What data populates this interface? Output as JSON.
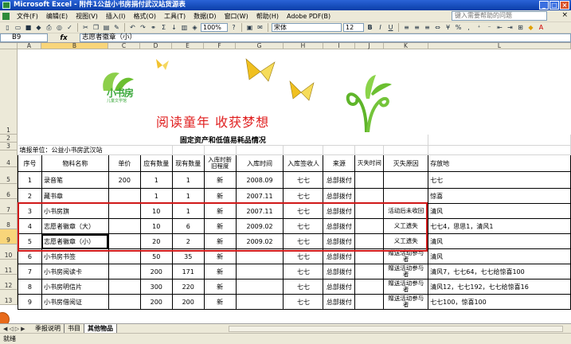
{
  "window": {
    "title": "Microsoft Excel - 附件1公益小书房捐付武汉站货源表",
    "controls": [
      "_",
      "□",
      "×"
    ]
  },
  "menu": {
    "items": [
      "文件(F)",
      "编辑(E)",
      "视图(V)",
      "插入(I)",
      "格式(O)",
      "工具(T)",
      "数据(D)",
      "窗口(W)",
      "帮助(H)",
      "Adobe PDF(B)"
    ],
    "help_placeholder": "键入需要帮助的问题",
    "close": "× "
  },
  "toolbar": {
    "zoom": "100%",
    "font": "宋体",
    "font_size": "12",
    "bold": "B",
    "italic": "I",
    "underline": "U"
  },
  "formula_bar": {
    "name_box": "B9",
    "fx": "fx",
    "content": "志愿者徽章（小）"
  },
  "columns": [
    "A",
    "B",
    "C",
    "D",
    "E",
    "F",
    "G",
    "H",
    "I",
    "J",
    "K",
    "L"
  ],
  "rows": [
    "1",
    "2",
    "3",
    "4",
    "5",
    "6",
    "7",
    "8",
    "9",
    "10",
    "11",
    "12",
    "13"
  ],
  "banner": {
    "title": "阅读童年  收获梦想",
    "logo": "小书房",
    "logo_sub": "儿童文学馆"
  },
  "sheet": {
    "table_title": "固定资产和低值易耗品情况",
    "unit_label": "填报单位：公益小书房武汉站",
    "headers": [
      "序号",
      "物料名称",
      "单价",
      "应有数量",
      "现有数量",
      "入库时新旧程度",
      "入库时间",
      "入库签收人",
      "来源",
      "灭失时间",
      "灭失原因",
      "存放地"
    ],
    "records": [
      [
        "1",
        "录音笔",
        "200",
        "1",
        "1",
        "新",
        "2008.09",
        "七七",
        "总部拨付",
        "",
        "",
        "七七"
      ],
      [
        "2",
        "藏书章",
        "",
        "1",
        "1",
        "新",
        "2007.11",
        "七七",
        "总部拨付",
        "",
        "",
        "惊喜"
      ],
      [
        "3",
        "小书房旗",
        "",
        "10",
        "1",
        "新",
        "2007.11",
        "七七",
        "总部拨付",
        "",
        "活动后未收回",
        "清风"
      ],
      [
        "4",
        "志愿者徽章（大）",
        "",
        "10",
        "6",
        "新",
        "2009.02",
        "七七",
        "总部拨付",
        "",
        "义工遗失",
        "七七4，思思1，清风1"
      ],
      [
        "5",
        "志愿者徽章（小）",
        "",
        "20",
        "2",
        "新",
        "2009.02",
        "七七",
        "总部拨付",
        "",
        "义工遗失",
        "清风"
      ],
      [
        "6",
        "小书房书签",
        "",
        "50",
        "35",
        "新",
        "",
        "七七",
        "总部拨付",
        "",
        "赠送活动参与者",
        "清风"
      ],
      [
        "7",
        "小书房阅读卡",
        "",
        "200",
        "171",
        "新",
        "",
        "七七",
        "总部拨付",
        "",
        "赠送活动参与者",
        "清风7，七七64，七七给惊喜100"
      ],
      [
        "8",
        "小书房明信片",
        "",
        "300",
        "220",
        "新",
        "",
        "七七",
        "总部拨付",
        "",
        "赠送活动参与者",
        "清风12，七七192，七七给惊喜16"
      ],
      [
        "9",
        "小书房借阅证",
        "",
        "200",
        "200",
        "新",
        "",
        "七七",
        "总部拨付",
        "",
        "赠送活动参与者",
        "七七100，惊喜100"
      ]
    ]
  },
  "tabs": [
    "季报说明",
    "书目",
    "其他物品"
  ],
  "status": "就绪"
}
